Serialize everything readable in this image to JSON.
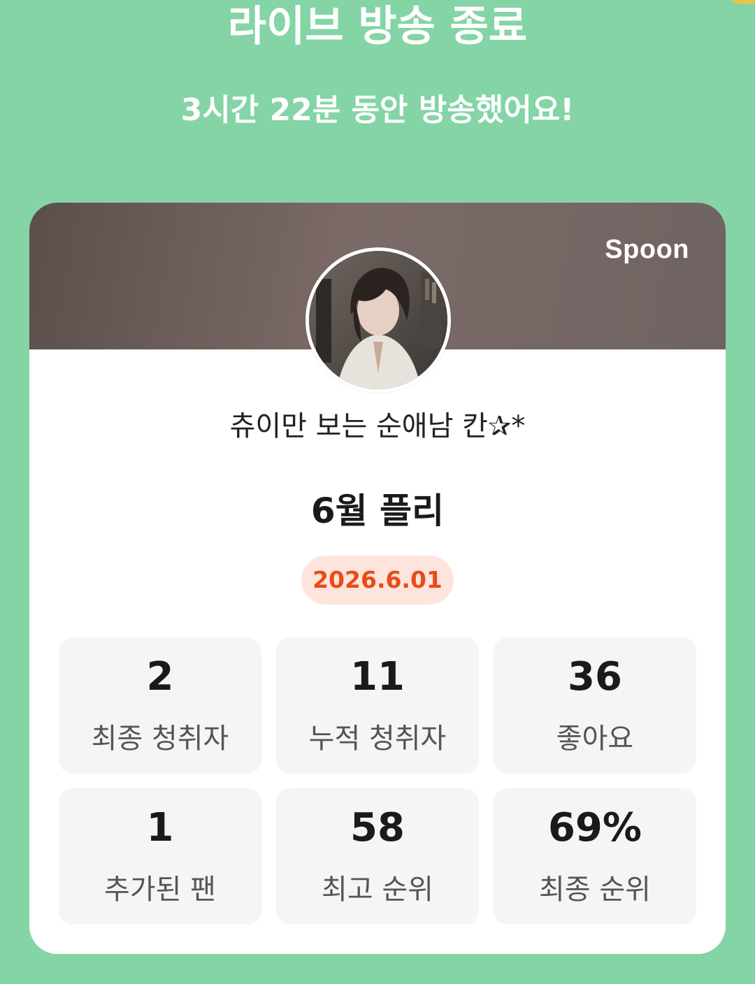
{
  "header": {
    "title": "라이브 방송 종료",
    "subtitle": "3시간 22분 동안 방송했어요!"
  },
  "card": {
    "brand": "Spoon",
    "streamer_name": "츄이만 보는 순애남 칸✰*",
    "broadcast_title": "6월 플리",
    "date": "2026.6.01",
    "stats": [
      {
        "value": "2",
        "label": "최종 청취자"
      },
      {
        "value": "11",
        "label": "누적 청취자"
      },
      {
        "value": "36",
        "label": "좋아요"
      },
      {
        "value": "1",
        "label": "추가된 팬"
      },
      {
        "value": "58",
        "label": "최고 순위"
      },
      {
        "value": "69%",
        "label": "최종 순위"
      }
    ]
  },
  "colors": {
    "background": "#84d4a6",
    "date_text": "#e94c18",
    "date_badge": "#fde5dd"
  }
}
